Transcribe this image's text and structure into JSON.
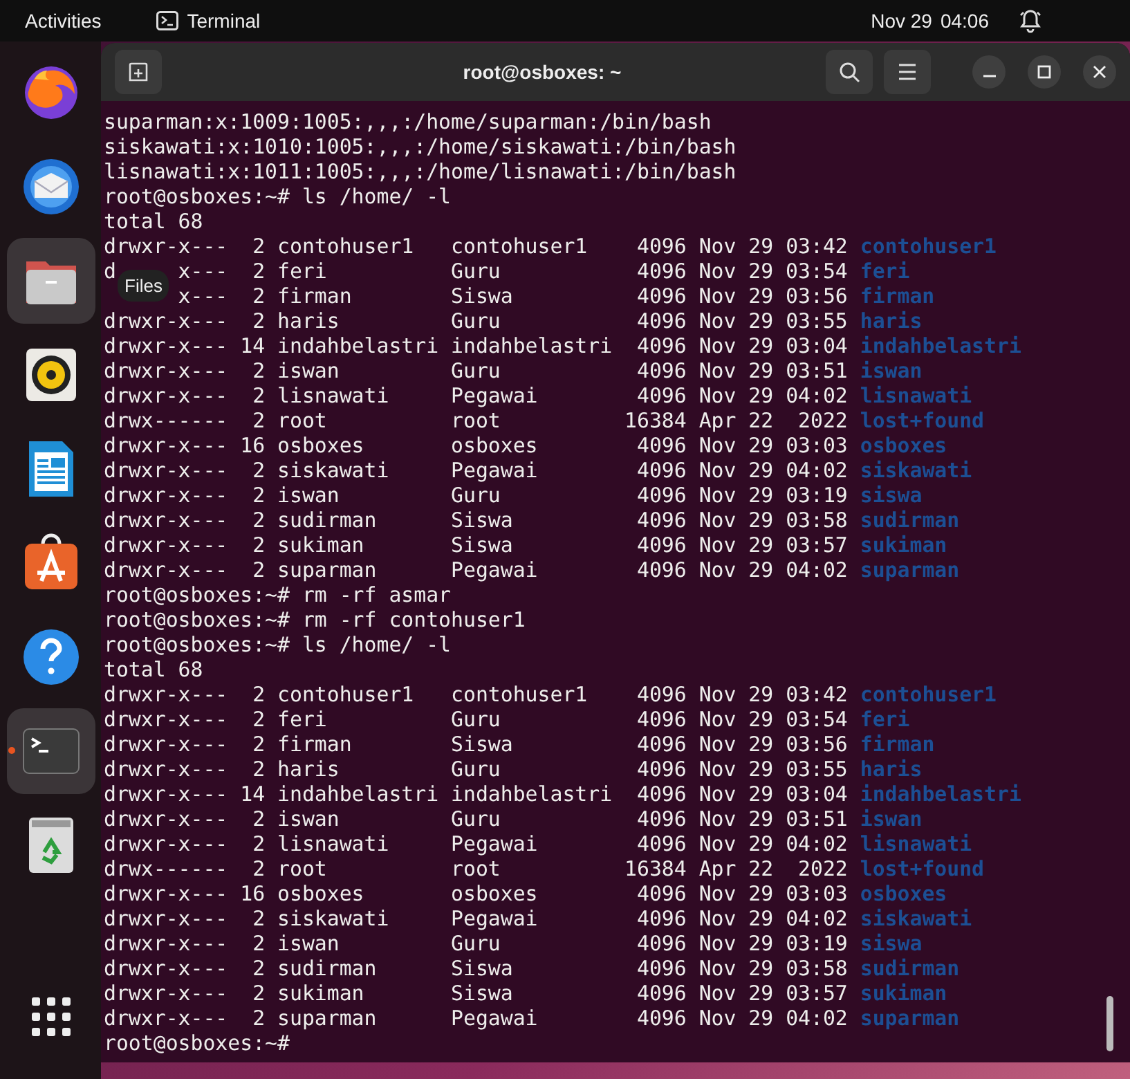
{
  "top_bar": {
    "activities": "Activities",
    "app_name": "Terminal",
    "date": "Nov 29",
    "time": "04:06"
  },
  "dock": {
    "items": [
      {
        "kind": "firefox",
        "highlighted": false,
        "running": false
      },
      {
        "kind": "mail",
        "highlighted": false,
        "running": false
      },
      {
        "kind": "files",
        "highlighted": true,
        "running": false
      },
      {
        "kind": "music",
        "highlighted": false,
        "running": false
      },
      {
        "kind": "writer",
        "highlighted": false,
        "running": false
      },
      {
        "kind": "store",
        "highlighted": false,
        "running": false
      },
      {
        "kind": "help",
        "highlighted": false,
        "running": false
      },
      {
        "kind": "terminal",
        "highlighted": true,
        "running": true
      },
      {
        "kind": "trash",
        "highlighted": false,
        "running": false
      }
    ],
    "tooltip": "Files"
  },
  "window": {
    "title": "root@osboxes: ~",
    "lines": [
      {
        "kind": "text",
        "text": "suparman:x:1009:1005:,,,:/home/suparman:/bin/bash"
      },
      {
        "kind": "text",
        "text": "siskawati:x:1010:1005:,,,:/home/siskawati:/bin/bash"
      },
      {
        "kind": "text",
        "text": "lisnawati:x:1011:1005:,,,:/home/lisnawati:/bin/bash"
      },
      {
        "kind": "text",
        "text": "root@osboxes:~# ls /home/ -l"
      },
      {
        "kind": "text",
        "text": "total 68"
      },
      {
        "kind": "entry",
        "info": "drwxr-x---  2 contohuser1   contohuser1    4096 Nov 29 03:42",
        "name": "contohuser1"
      },
      {
        "kind": "entry",
        "covered": true,
        "lead": "d",
        "info": "x---  2 feri          Guru           4096 Nov 29 03:54",
        "name": "feri"
      },
      {
        "kind": "entry",
        "covered": true,
        "info": "x---  2 firman        Siswa          4096 Nov 29 03:56",
        "name": "firman"
      },
      {
        "kind": "entry",
        "info": "drwxr-x---  2 haris         Guru           4096 Nov 29 03:55",
        "name": "haris"
      },
      {
        "kind": "entry",
        "info": "drwxr-x--- 14 indahbelastri indahbelastri  4096 Nov 29 03:04",
        "name": "indahbelastri"
      },
      {
        "kind": "entry",
        "info": "drwxr-x---  2 iswan         Guru           4096 Nov 29 03:51",
        "name": "iswan"
      },
      {
        "kind": "entry",
        "info": "drwxr-x---  2 lisnawati     Pegawai        4096 Nov 29 04:02",
        "name": "lisnawati"
      },
      {
        "kind": "entry",
        "info": "drwx------  2 root          root          16384 Apr 22  2022",
        "name": "lost+found"
      },
      {
        "kind": "entry",
        "info": "drwxr-x--- 16 osboxes       osboxes        4096 Nov 29 03:03",
        "name": "osboxes"
      },
      {
        "kind": "entry",
        "info": "drwxr-x---  2 siskawati     Pegawai        4096 Nov 29 04:02",
        "name": "siskawati"
      },
      {
        "kind": "entry",
        "info": "drwxr-x---  2 iswan         Guru           4096 Nov 29 03:19",
        "name": "siswa"
      },
      {
        "kind": "entry",
        "info": "drwxr-x---  2 sudirman      Siswa          4096 Nov 29 03:58",
        "name": "sudirman"
      },
      {
        "kind": "entry",
        "info": "drwxr-x---  2 sukiman       Siswa          4096 Nov 29 03:57",
        "name": "sukiman"
      },
      {
        "kind": "entry",
        "info": "drwxr-x---  2 suparman      Pegawai        4096 Nov 29 04:02",
        "name": "suparman"
      },
      {
        "kind": "text",
        "text": "root@osboxes:~# rm -rf asmar"
      },
      {
        "kind": "text",
        "text": "root@osboxes:~# rm -rf contohuser1"
      },
      {
        "kind": "text",
        "text": "root@osboxes:~# ls /home/ -l"
      },
      {
        "kind": "text",
        "text": "total 68"
      },
      {
        "kind": "entry",
        "info": "drwxr-x---  2 contohuser1   contohuser1    4096 Nov 29 03:42",
        "name": "contohuser1"
      },
      {
        "kind": "entry",
        "info": "drwxr-x---  2 feri          Guru           4096 Nov 29 03:54",
        "name": "feri"
      },
      {
        "kind": "entry",
        "info": "drwxr-x---  2 firman        Siswa          4096 Nov 29 03:56",
        "name": "firman"
      },
      {
        "kind": "entry",
        "info": "drwxr-x---  2 haris         Guru           4096 Nov 29 03:55",
        "name": "haris"
      },
      {
        "kind": "entry",
        "info": "drwxr-x--- 14 indahbelastri indahbelastri  4096 Nov 29 03:04",
        "name": "indahbelastri"
      },
      {
        "kind": "entry",
        "info": "drwxr-x---  2 iswan         Guru           4096 Nov 29 03:51",
        "name": "iswan"
      },
      {
        "kind": "entry",
        "info": "drwxr-x---  2 lisnawati     Pegawai        4096 Nov 29 04:02",
        "name": "lisnawati"
      },
      {
        "kind": "entry",
        "info": "drwx------  2 root          root          16384 Apr 22  2022",
        "name": "lost+found"
      },
      {
        "kind": "entry",
        "info": "drwxr-x--- 16 osboxes       osboxes        4096 Nov 29 03:03",
        "name": "osboxes"
      },
      {
        "kind": "entry",
        "info": "drwxr-x---  2 siskawati     Pegawai        4096 Nov 29 04:02",
        "name": "siskawati"
      },
      {
        "kind": "entry",
        "info": "drwxr-x---  2 iswan         Guru           4096 Nov 29 03:19",
        "name": "siswa"
      },
      {
        "kind": "entry",
        "info": "drwxr-x---  2 sudirman      Siswa          4096 Nov 29 03:58",
        "name": "sudirman"
      },
      {
        "kind": "entry",
        "info": "drwxr-x---  2 sukiman       Siswa          4096 Nov 29 03:57",
        "name": "sukiman"
      },
      {
        "kind": "entry",
        "info": "drwxr-x---  2 suparman      Pegawai        4096 Nov 29 04:02",
        "name": "suparman"
      },
      {
        "kind": "text",
        "text": "root@osboxes:~#"
      }
    ]
  }
}
